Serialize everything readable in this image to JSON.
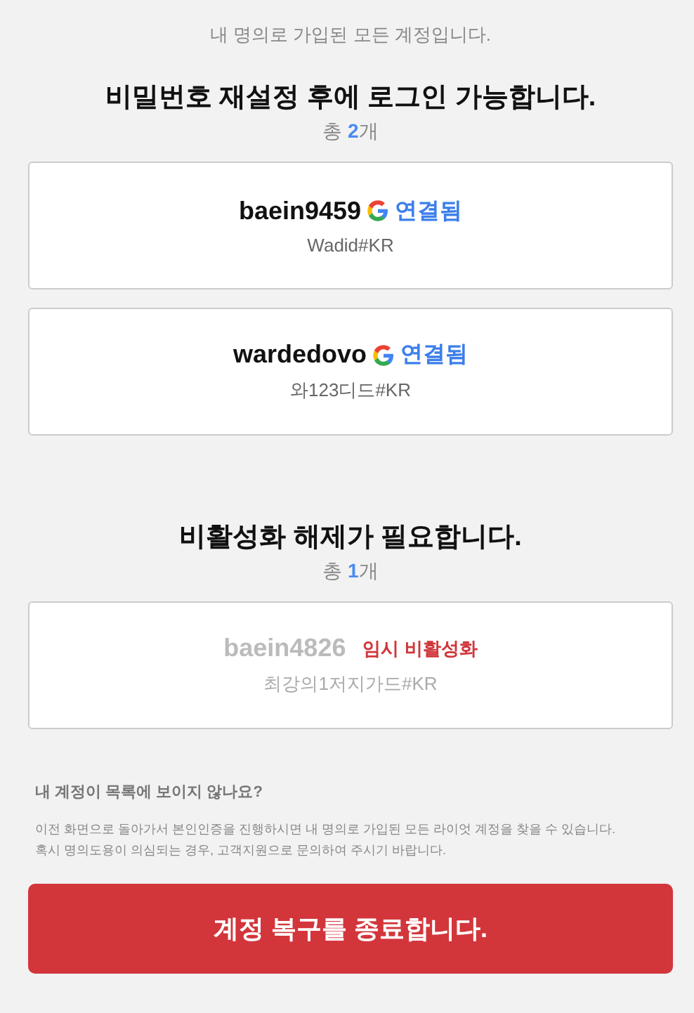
{
  "intro": "내 명의로 가입된 모든 계정입니다.",
  "sections": [
    {
      "title": "비밀번호 재설정 후에 로그인 가능합니다.",
      "count": {
        "prefix": "총",
        "number": "2",
        "suffix": "개"
      },
      "accounts": [
        {
          "name": "baein9459",
          "kind": "linked",
          "status": "연결됨",
          "tag": "Wadid#KR"
        },
        {
          "name": "wardedovo",
          "kind": "linked",
          "status": "연결됨",
          "tag": "와123디드#KR"
        }
      ]
    },
    {
      "title": "비활성화 해제가 필요합니다.",
      "count": {
        "prefix": "총",
        "number": "1",
        "suffix": "개"
      },
      "accounts": [
        {
          "name": "baein4826",
          "kind": "disabled",
          "status": "임시 비활성화",
          "tag": "최강의1저지가드#KR"
        }
      ]
    }
  ],
  "help": {
    "title": "내 계정이 목록에 보이지 않나요?",
    "text": "이전 화면으로 돌아가서 본인인증을 진행하시면 내 명의로 가입된 모든 라이엇 계정을 찾을 수 있습니다. 혹시 명의도용이 의심되는 경우, 고객지원으로 문의하여 주시기 바랍니다."
  },
  "button": "계정 복구를 종료합니다."
}
